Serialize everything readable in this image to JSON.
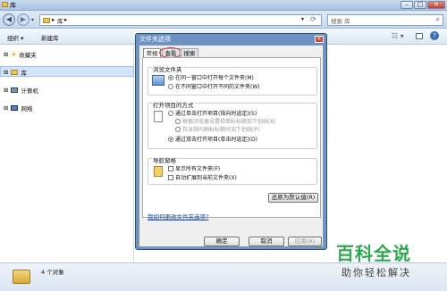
{
  "window": {
    "title": "库"
  },
  "address": {
    "path": "库",
    "search_placeholder": "搜索 库"
  },
  "toolbar": {
    "organize": "组织",
    "new_library": "新建库"
  },
  "nav": {
    "items": [
      "收藏夹",
      "库",
      "计算机",
      "网络"
    ]
  },
  "status": {
    "text": "4 个对象"
  },
  "dialog": {
    "title": "文件夹选项",
    "tabs": [
      "常规",
      "查看",
      "搜索"
    ],
    "browse_group": {
      "label": "浏览文件夹",
      "options": [
        "在同一窗口中打开每个文件夹(M)",
        "在不同窗口中打开不同的文件夹(W)"
      ]
    },
    "open_group": {
      "label": "打开项目的方式",
      "options": [
        "通过单击打开项目(指向时选定)(S)",
        "根据浏览器设置给图标标题加下划线(B)",
        "仅当指向图标标题时加下划线(P)",
        "通过双击打开项目(单击时选定)(D)"
      ]
    },
    "nav_group": {
      "label": "导航窗格",
      "options": [
        "显示所有文件夹(F)",
        "自动扩展到当前文件夹(X)"
      ]
    },
    "restore_button": "还原为默认值(R)",
    "help_link": "我如何更改文件夹选项?",
    "buttons": [
      "确定",
      "取消",
      "应用(A)"
    ]
  },
  "watermark": {
    "title": "百科全说",
    "subtitle": "助你轻松解决"
  },
  "colors": {
    "accent": "#2fa84f",
    "highlight": "#d9333f"
  }
}
